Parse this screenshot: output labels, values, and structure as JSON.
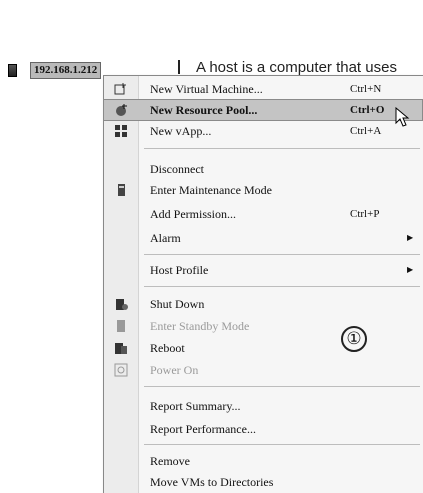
{
  "host": {
    "label": "192.168.1.212"
  },
  "background": {
    "text": "A host is a computer that uses"
  },
  "annotation": {
    "marker": "①"
  },
  "menu": {
    "items": [
      {
        "label": "New Virtual Machine...",
        "shortcut": "Ctrl+N",
        "icon": "new-vm-icon"
      },
      {
        "label": "New Resource Pool...",
        "shortcut": "Ctrl+O",
        "icon": "resource-pool-icon"
      },
      {
        "label": "New vApp...",
        "shortcut": "Ctrl+A",
        "icon": "vapp-icon"
      },
      {
        "label": "Disconnect",
        "shortcut": ""
      },
      {
        "label": "Enter Maintenance Mode",
        "shortcut": "",
        "icon": "maintenance-icon"
      },
      {
        "label": "Add Permission...",
        "shortcut": "Ctrl+P"
      },
      {
        "label": "Alarm",
        "submenu": true
      },
      {
        "label": "Host Profile",
        "submenu": true
      },
      {
        "label": "Shut Down",
        "icon": "shutdown-icon"
      },
      {
        "label": "Enter Standby Mode",
        "icon": "standby-icon",
        "disabled": true
      },
      {
        "label": "Reboot",
        "icon": "reboot-icon"
      },
      {
        "label": "Power On",
        "icon": "power-on-icon",
        "disabled": true
      },
      {
        "label": "Report Summary..."
      },
      {
        "label": "Report Performance..."
      },
      {
        "label": "Remove"
      },
      {
        "label": "Move VMs to Directories"
      }
    ],
    "highlighted": "New Resource Pool..."
  },
  "colors": {
    "highlight": "#c4c4c4",
    "disabled_text": "#9a9a9a"
  }
}
